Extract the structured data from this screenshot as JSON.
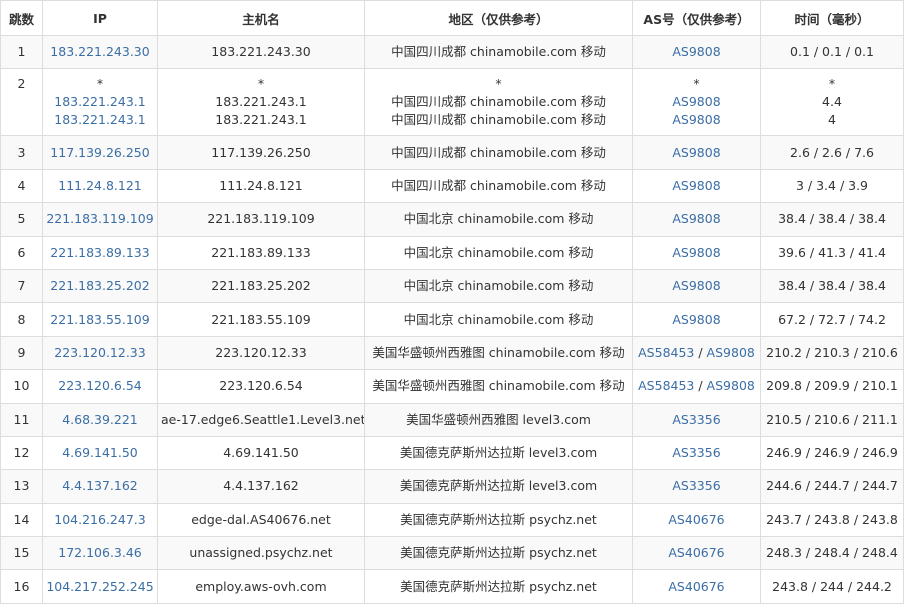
{
  "headers": {
    "hop": "跳数",
    "ip": "IP",
    "host": "主机名",
    "region": "地区（仅供参考）",
    "as": "AS号（仅供参考）",
    "time": "时间（毫秒）"
  },
  "colors": {
    "link": "#3b6ea5",
    "text": "#333333",
    "border": "#dddddd",
    "stripe": "#f9f9f9"
  },
  "rows": [
    {
      "hop": "1",
      "ip": [
        "183.221.243.30"
      ],
      "host": [
        "183.221.243.30"
      ],
      "region": [
        "中国四川成都 chinamobile.com 移动"
      ],
      "as": [
        [
          "AS9808"
        ]
      ],
      "time": [
        "0.1 / 0.1 / 0.1"
      ]
    },
    {
      "hop": "2",
      "ip": [
        "*",
        "183.221.243.1",
        "183.221.243.1"
      ],
      "host": [
        "*",
        "183.221.243.1",
        "183.221.243.1"
      ],
      "region": [
        "*",
        "中国四川成都 chinamobile.com 移动",
        "中国四川成都 chinamobile.com 移动"
      ],
      "as": [
        [
          "*"
        ],
        [
          "AS9808"
        ],
        [
          "AS9808"
        ]
      ],
      "time": [
        "*",
        "4.4",
        "4"
      ]
    },
    {
      "hop": "3",
      "ip": [
        "117.139.26.250"
      ],
      "host": [
        "117.139.26.250"
      ],
      "region": [
        "中国四川成都 chinamobile.com 移动"
      ],
      "as": [
        [
          "AS9808"
        ]
      ],
      "time": [
        "2.6 / 2.6 / 7.6"
      ]
    },
    {
      "hop": "4",
      "ip": [
        "111.24.8.121"
      ],
      "host": [
        "111.24.8.121"
      ],
      "region": [
        "中国四川成都 chinamobile.com 移动"
      ],
      "as": [
        [
          "AS9808"
        ]
      ],
      "time": [
        "3 / 3.4 / 3.9"
      ]
    },
    {
      "hop": "5",
      "ip": [
        "221.183.119.109"
      ],
      "host": [
        "221.183.119.109"
      ],
      "region": [
        "中国北京 chinamobile.com 移动"
      ],
      "as": [
        [
          "AS9808"
        ]
      ],
      "time": [
        "38.4 / 38.4 / 38.4"
      ]
    },
    {
      "hop": "6",
      "ip": [
        "221.183.89.133"
      ],
      "host": [
        "221.183.89.133"
      ],
      "region": [
        "中国北京 chinamobile.com 移动"
      ],
      "as": [
        [
          "AS9808"
        ]
      ],
      "time": [
        "39.6 / 41.3 / 41.4"
      ]
    },
    {
      "hop": "7",
      "ip": [
        "221.183.25.202"
      ],
      "host": [
        "221.183.25.202"
      ],
      "region": [
        "中国北京 chinamobile.com 移动"
      ],
      "as": [
        [
          "AS9808"
        ]
      ],
      "time": [
        "38.4 / 38.4 / 38.4"
      ]
    },
    {
      "hop": "8",
      "ip": [
        "221.183.55.109"
      ],
      "host": [
        "221.183.55.109"
      ],
      "region": [
        "中国北京 chinamobile.com 移动"
      ],
      "as": [
        [
          "AS9808"
        ]
      ],
      "time": [
        "67.2 / 72.7 / 74.2"
      ]
    },
    {
      "hop": "9",
      "ip": [
        "223.120.12.33"
      ],
      "host": [
        "223.120.12.33"
      ],
      "region": [
        "美国华盛顿州西雅图 chinamobile.com 移动"
      ],
      "as": [
        [
          "AS58453",
          "AS9808"
        ]
      ],
      "time": [
        "210.2 / 210.3 / 210.6"
      ]
    },
    {
      "hop": "10",
      "ip": [
        "223.120.6.54"
      ],
      "host": [
        "223.120.6.54"
      ],
      "region": [
        "美国华盛顿州西雅图 chinamobile.com 移动"
      ],
      "as": [
        [
          "AS58453",
          "AS9808"
        ]
      ],
      "time": [
        "209.8 / 209.9 / 210.1"
      ]
    },
    {
      "hop": "11",
      "ip": [
        "4.68.39.221"
      ],
      "host": [
        "ae-17.edge6.Seattle1.Level3.net"
      ],
      "region": [
        "美国华盛顿州西雅图 level3.com"
      ],
      "as": [
        [
          "AS3356"
        ]
      ],
      "time": [
        "210.5 / 210.6 / 211.1"
      ]
    },
    {
      "hop": "12",
      "ip": [
        "4.69.141.50"
      ],
      "host": [
        "4.69.141.50"
      ],
      "region": [
        "美国德克萨斯州达拉斯 level3.com"
      ],
      "as": [
        [
          "AS3356"
        ]
      ],
      "time": [
        "246.9 / 246.9 / 246.9"
      ]
    },
    {
      "hop": "13",
      "ip": [
        "4.4.137.162"
      ],
      "host": [
        "4.4.137.162"
      ],
      "region": [
        "美国德克萨斯州达拉斯 level3.com"
      ],
      "as": [
        [
          "AS3356"
        ]
      ],
      "time": [
        "244.6 / 244.7 / 244.7"
      ]
    },
    {
      "hop": "14",
      "ip": [
        "104.216.247.3"
      ],
      "host": [
        "edge-dal.AS40676.net"
      ],
      "region": [
        "美国德克萨斯州达拉斯 psychz.net"
      ],
      "as": [
        [
          "AS40676"
        ]
      ],
      "time": [
        "243.7 / 243.8 / 243.8"
      ]
    },
    {
      "hop": "15",
      "ip": [
        "172.106.3.46"
      ],
      "host": [
        "unassigned.psychz.net"
      ],
      "region": [
        "美国德克萨斯州达拉斯 psychz.net"
      ],
      "as": [
        [
          "AS40676"
        ]
      ],
      "time": [
        "248.3 / 248.4 / 248.4"
      ]
    },
    {
      "hop": "16",
      "ip": [
        "104.217.252.245"
      ],
      "host": [
        "employ.aws-ovh.com"
      ],
      "region": [
        "美国德克萨斯州达拉斯 psychz.net"
      ],
      "as": [
        [
          "AS40676"
        ]
      ],
      "time": [
        "243.8 / 244 / 244.2"
      ]
    }
  ]
}
